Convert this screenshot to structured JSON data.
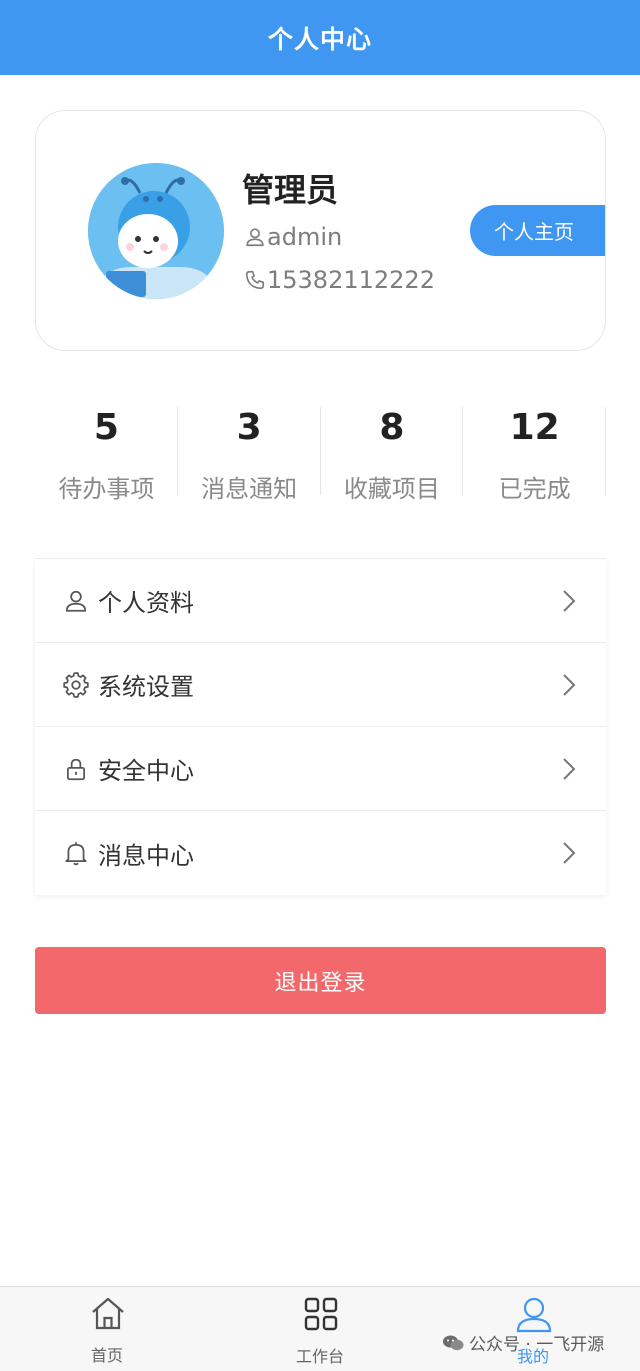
{
  "header": {
    "title": "个人中心"
  },
  "profile": {
    "name": "管理员",
    "username": "admin",
    "phone": "15382112222",
    "homepage_button": "个人主页"
  },
  "stats": [
    {
      "value": "5",
      "label": "待办事项"
    },
    {
      "value": "3",
      "label": "消息通知"
    },
    {
      "value": "8",
      "label": "收藏项目"
    },
    {
      "value": "12",
      "label": "已完成"
    }
  ],
  "menu": [
    {
      "label": "个人资料",
      "icon": "user-icon"
    },
    {
      "label": "系统设置",
      "icon": "gear-icon"
    },
    {
      "label": "安全中心",
      "icon": "lock-icon"
    },
    {
      "label": "消息中心",
      "icon": "bell-icon"
    }
  ],
  "logout": {
    "label": "退出登录"
  },
  "tabbar": {
    "items": [
      {
        "label": "首页",
        "icon": "home-icon",
        "active": false
      },
      {
        "label": "工作台",
        "icon": "grid-icon",
        "active": false
      },
      {
        "label": "我的",
        "icon": "user-icon",
        "active": true
      }
    ]
  },
  "watermark": {
    "text": "公众号 · 一飞开源"
  },
  "colors": {
    "primary": "#3f97f2",
    "danger": "#f2686b",
    "muted_text": "#8a8a8a"
  }
}
